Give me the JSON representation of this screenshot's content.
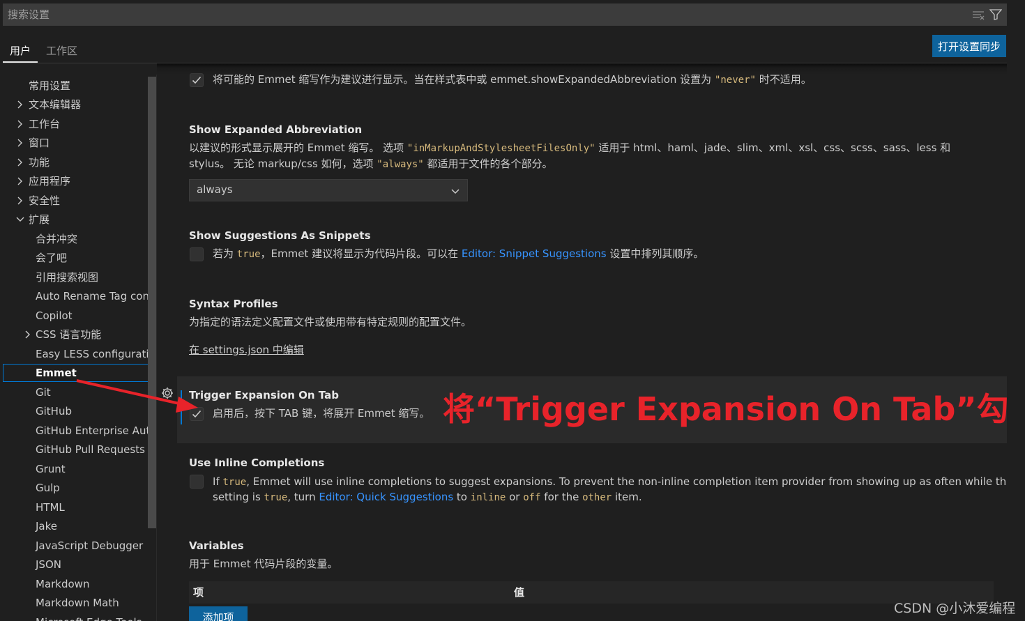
{
  "search": {
    "placeholder": "搜索设置"
  },
  "tabs": [
    {
      "label": "用户"
    },
    {
      "label": "工作区"
    }
  ],
  "sync_button": "打开设置同步",
  "toc": [
    {
      "label": "常用设置",
      "chevron": "none"
    },
    {
      "label": "文本编辑器",
      "chevron": "right"
    },
    {
      "label": "工作台",
      "chevron": "right"
    },
    {
      "label": "窗口",
      "chevron": "right"
    },
    {
      "label": "功能",
      "chevron": "right"
    },
    {
      "label": "应用程序",
      "chevron": "right"
    },
    {
      "label": "安全性",
      "chevron": "right"
    },
    {
      "label": "扩展",
      "chevron": "down"
    },
    {
      "label": "合并冲突",
      "chevron": "none"
    },
    {
      "label": "会了吧",
      "chevron": "none"
    },
    {
      "label": "引用搜索视图",
      "chevron": "none"
    },
    {
      "label": "Auto Rename Tag con...",
      "chevron": "none"
    },
    {
      "label": "Copilot",
      "chevron": "none"
    },
    {
      "label": "CSS 语言功能",
      "chevron": "right"
    },
    {
      "label": "Easy LESS configuration",
      "chevron": "none"
    },
    {
      "label": "Emmet",
      "chevron": "none"
    },
    {
      "label": "Git",
      "chevron": "none"
    },
    {
      "label": "GitHub",
      "chevron": "none"
    },
    {
      "label": "GitHub Enterprise Aut...",
      "chevron": "none"
    },
    {
      "label": "GitHub Pull Requests",
      "chevron": "none"
    },
    {
      "label": "Grunt",
      "chevron": "none"
    },
    {
      "label": "Gulp",
      "chevron": "none"
    },
    {
      "label": "HTML",
      "chevron": "none"
    },
    {
      "label": "Jake",
      "chevron": "none"
    },
    {
      "label": "JavaScript Debugger",
      "chevron": "none"
    },
    {
      "label": "JSON",
      "chevron": "none"
    },
    {
      "label": "Markdown",
      "chevron": "none"
    },
    {
      "label": "Markdown Math",
      "chevron": "none"
    },
    {
      "label": "Microsoft Edge Tools",
      "chevron": "none"
    }
  ],
  "settings": {
    "top_partial": {
      "text_1": "将可能的 Emmet 缩写作为建议进行显示。当在样式表中或 emmet.showExpandedAbbreviation 设置为 ",
      "code_1": "\"never\"",
      "text_2": " 时不适用。",
      "checked": true
    },
    "show_expanded": {
      "title": "Show Expanded Abbreviation",
      "line1_a": "以建议的形式显示展开的 Emmet 缩写。 选项 ",
      "line1_code": "\"inMarkupAndStylesheetFilesOnly\"",
      "line1_b": " 适用于 html、haml、jade、slim、xml、xsl、css、scss、sass、less 和",
      "line2_a": "stylus。 无论 markup/css 如何，选项 ",
      "line2_code": "\"always\"",
      "line2_b": " 都适用于文件的各个部分。",
      "value": "always"
    },
    "snippets": {
      "title": "Show Suggestions As Snippets",
      "a": "若为 ",
      "code": "true",
      "b": "，Emmet 建议将显示为代码片段。可以在 ",
      "link": "Editor: Snippet Suggestions",
      "c": " 设置中排列其顺序。",
      "checked": false
    },
    "syntax": {
      "title": "Syntax Profiles",
      "desc": "为指定的语法定义配置文件或使用带有特定规则的配置文件。",
      "edit_link": "在 settings.json 中编辑"
    },
    "trigger": {
      "title": "Trigger Expansion On Tab",
      "desc": "启用后，按下 TAB 键，将展开 Emmet 缩写。",
      "checked": true
    },
    "inline": {
      "title": "Use Inline Completions",
      "l1_a": "If ",
      "l1_code": "true",
      "l1_b": ", Emmet will use inline completions to suggest expansions. To prevent the non-inline completion item provider from showing up as often while this",
      "l2_a": "setting is ",
      "l2_code1": "true",
      "l2_b": ", turn ",
      "l2_link": "Editor: Quick Suggestions",
      "l2_c": " to ",
      "l2_code2": "inline",
      "l2_d": " or ",
      "l2_code3": "off",
      "l2_e": " for the ",
      "l2_code4": "other",
      "l2_f": " item.",
      "checked": false
    },
    "variables": {
      "title": "Variables",
      "desc": "用于 Emmet 代码片段的变量。",
      "col_item": "项",
      "col_value": "值",
      "add_button": "添加项"
    }
  },
  "annotation": "将“Trigger Expansion On Tab”勾选✔",
  "watermark": "CSDN @小沐爱编程",
  "colors": {
    "accent": "#0078d4",
    "button": "#0e639c",
    "annotation": "#e8232a",
    "code": "#d7ba7d",
    "link": "#3794ff"
  }
}
